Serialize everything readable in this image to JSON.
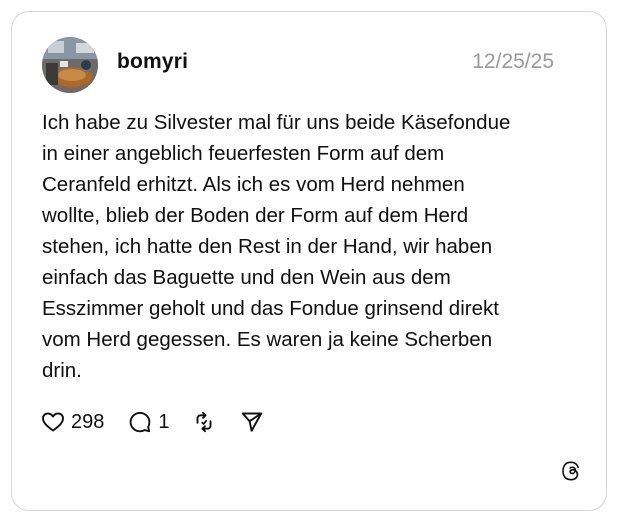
{
  "post": {
    "username": "bomyri",
    "timestamp": "12/25/25",
    "avatar_icon": "avatar-photo",
    "text": "Ich habe zu Silvester mal für uns beide Käsefondue\nin einer angeblich  feuerfesten Form auf dem\nCeranfeld erhitzt. Als ich es vom Herd nehmen\nwollte, blieb der Boden der Form auf dem Herd\nstehen, ich hatte den Rest in der Hand, wir haben\neinfach das Baguette und den Wein aus dem\nEsszimmer geholt und das Fondue grinsend direkt\nvom Herd gegessen. Es waren ja keine Scherben\ndrin."
  },
  "actions": {
    "like": {
      "icon": "heart-icon",
      "count": "298"
    },
    "reply": {
      "icon": "comment-icon",
      "count": "1"
    },
    "repost": {
      "icon": "repost-icon"
    },
    "share": {
      "icon": "send-icon"
    }
  },
  "brand": {
    "icon": "threads-logo",
    "color": "#101010"
  },
  "colors": {
    "text": "#101010",
    "muted": "#9a9a9a",
    "border": "#d6d6d6"
  }
}
